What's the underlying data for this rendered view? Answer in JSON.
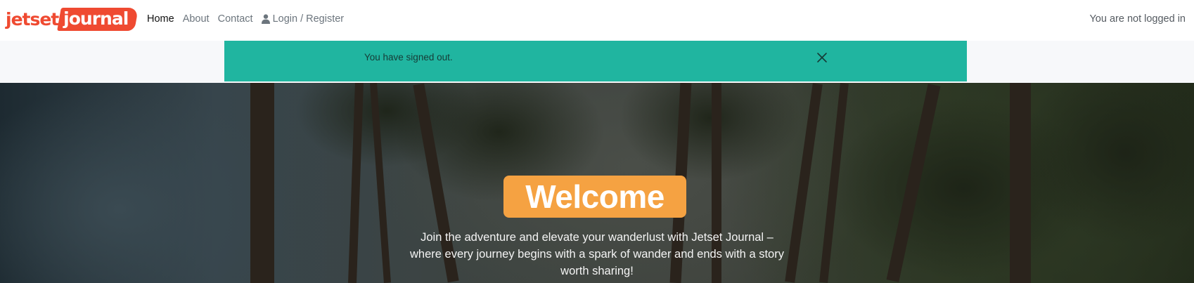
{
  "navbar": {
    "brand": {
      "word1": "jetset",
      "word2": "journal"
    },
    "links": [
      {
        "label": "Home",
        "active": true
      },
      {
        "label": "About",
        "active": false
      },
      {
        "label": "Contact",
        "active": false
      },
      {
        "label": "Login / Register",
        "active": false,
        "icon": "user-icon"
      }
    ],
    "status": "You are not logged in"
  },
  "alert": {
    "message": "You have signed out.",
    "close_icon": "close-icon",
    "color": "#20b5a0"
  },
  "hero": {
    "title": "Welcome",
    "tagline": "Join the adventure and elevate your wanderlust with Jetset Journal – where every journey begins with a spark of wander and ends with a story worth sharing!",
    "badge_color": "#f5a242"
  },
  "colors": {
    "brand": "#ef4a31",
    "accent": "#f5a242"
  }
}
